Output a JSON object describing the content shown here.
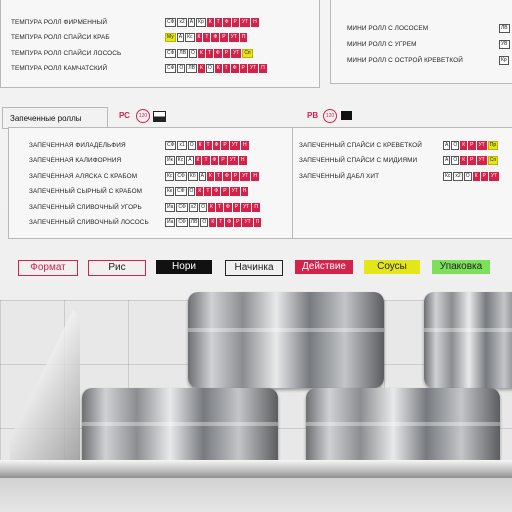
{
  "top_left": {
    "rows": [
      {
        "name": "ТЕМПУРА РОЛЛ ФИРМЕННЫЙ",
        "codes": [
          [
            "СФ",
            ""
          ],
          [
            "х2",
            ""
          ],
          [
            "А",
            ""
          ],
          [
            "Кр",
            ""
          ],
          [
            "К",
            "d"
          ],
          [
            "Т",
            "d"
          ],
          [
            "Ф",
            "d"
          ],
          [
            "Р",
            "d"
          ],
          [
            "УТ",
            "d"
          ],
          [
            "Н",
            "d"
          ]
        ]
      },
      {
        "name": "ТЕМПУРА РОЛЛ СПАЙСИ КРАБ",
        "codes": [
          [
            "Му",
            "s"
          ],
          [
            "А",
            ""
          ],
          [
            "Кс",
            ""
          ],
          [
            "К",
            "d"
          ],
          [
            "Т",
            "d"
          ],
          [
            "Ф",
            "d"
          ],
          [
            "Р",
            "d"
          ],
          [
            "УТ",
            "d"
          ],
          [
            "П",
            "d"
          ]
        ]
      },
      {
        "name": "ТЕМПУРА РОЛЛ СПАЙСИ ЛОСОСЬ",
        "codes": [
          [
            "СФ",
            ""
          ],
          [
            "ЛВ",
            ""
          ],
          [
            "О",
            ""
          ],
          [
            "К",
            "d"
          ],
          [
            "Т",
            "d"
          ],
          [
            "Ф",
            "d"
          ],
          [
            "Р",
            "d"
          ],
          [
            "УТ",
            "d"
          ],
          [
            "Сп",
            "s"
          ]
        ]
      },
      {
        "name": "ТЕМПУРА РОЛЛ КАМЧАТСКИЙ",
        "codes": [
          [
            "СФ",
            ""
          ],
          [
            "О",
            ""
          ],
          [
            "ЛВ",
            ""
          ],
          [
            "К",
            "d"
          ],
          [
            "О",
            ""
          ],
          [
            "К",
            "d"
          ],
          [
            "Т",
            "d"
          ],
          [
            "Ф",
            "d"
          ],
          [
            "Р",
            "d"
          ],
          [
            "УТ",
            "d"
          ],
          [
            "П",
            "d"
          ]
        ]
      }
    ]
  },
  "top_right": {
    "rows": [
      {
        "name": "МИНИ РОЛЛ С ЛОСОСЕМ",
        "code": "ЛВ"
      },
      {
        "name": "МИНИ РОЛЛ С УГРЕМ",
        "code": "УВ"
      },
      {
        "name": "МИНИ РОЛЛ С ОСТРОЙ КРЕВЕТКОЙ",
        "code": "Кр"
      }
    ]
  },
  "baked": {
    "title": "Запеченные роллы",
    "badge_left": "РС",
    "circle_left": "120",
    "badge_right": "РВ",
    "circle_right": "120",
    "left_rows": [
      {
        "name": "ЗАПЕЧЕННАЯ ФИЛАДЕЛЬФИЯ",
        "codes": [
          [
            "СФ",
            ""
          ],
          [
            "х1",
            ""
          ],
          [
            "О",
            ""
          ],
          [
            "К",
            "d"
          ],
          [
            "Т",
            "d"
          ],
          [
            "Ф",
            "d"
          ],
          [
            "Р",
            "d"
          ],
          [
            "УТ",
            "d"
          ],
          [
            "Н",
            "d"
          ]
        ]
      },
      {
        "name": "ЗАПЕЧЕННАЯ КАЛИФОРНИЯ",
        "codes": [
          [
            "Ик",
            ""
          ],
          [
            "Кс",
            ""
          ],
          [
            "А",
            ""
          ],
          [
            "К",
            "d"
          ],
          [
            "Т",
            "d"
          ],
          [
            "Ф",
            "d"
          ],
          [
            "Р",
            "d"
          ],
          [
            "УТ",
            "d"
          ],
          [
            "Н",
            "d"
          ]
        ]
      },
      {
        "name": "ЗАПЕЧЕННАЯ АЛЯСКА С КРАБОМ",
        "codes": [
          [
            "Кс",
            ""
          ],
          [
            "СФ",
            ""
          ],
          [
            "Кб",
            ""
          ],
          [
            "А",
            ""
          ],
          [
            "К",
            "d"
          ],
          [
            "Т",
            "d"
          ],
          [
            "Ф",
            "d"
          ],
          [
            "Р",
            "d"
          ],
          [
            "УТ",
            "d"
          ],
          [
            "Н",
            "d"
          ]
        ]
      },
      {
        "name": "ЗАПЕЧЕННЫЙ СЫРНЫЙ С КРАБОМ",
        "codes": [
          [
            "Кк",
            ""
          ],
          [
            "СФ",
            ""
          ],
          [
            "О",
            ""
          ],
          [
            "К",
            "d"
          ],
          [
            "Т",
            "d"
          ],
          [
            "Ф",
            "d"
          ],
          [
            "Р",
            "d"
          ],
          [
            "УТ",
            "d"
          ],
          [
            "Н",
            "d"
          ]
        ]
      },
      {
        "name": "ЗАПЕЧЕННЫЙ СЛИВОЧНЫЙ УГОРЬ",
        "codes": [
          [
            "Иа",
            ""
          ],
          [
            "СФ",
            ""
          ],
          [
            "х2",
            ""
          ],
          [
            "О",
            ""
          ],
          [
            "К",
            "d"
          ],
          [
            "Т",
            "d"
          ],
          [
            "Ф",
            "d"
          ],
          [
            "Р",
            "d"
          ],
          [
            "УТ",
            "d"
          ],
          [
            "П",
            "d"
          ]
        ]
      },
      {
        "name": "ЗАПЕЧЕННЫЙ СЛИВОЧНЫЙ ЛОСОСЬ",
        "codes": [
          [
            "Иа",
            ""
          ],
          [
            "СФ",
            ""
          ],
          [
            "ЛВ",
            ""
          ],
          [
            "О",
            ""
          ],
          [
            "К",
            "d"
          ],
          [
            "Т",
            "d"
          ],
          [
            "Ф",
            "d"
          ],
          [
            "Р",
            "d"
          ],
          [
            "УТ",
            "d"
          ],
          [
            "П",
            "d"
          ]
        ]
      }
    ],
    "right_rows": [
      {
        "name": "ЗАПЕЧЕННЫЙ СПАЙСИ С КРЕВЕТКОЙ",
        "codes": [
          [
            "А",
            ""
          ],
          [
            "О",
            ""
          ],
          [
            "К",
            "d"
          ],
          [
            "Р",
            "d"
          ],
          [
            "УТ",
            "d"
          ],
          [
            "Пр",
            "s"
          ]
        ]
      },
      {
        "name": "ЗАПЕЧЕННЫЙ СПАЙСИ С МИДИЯМИ",
        "codes": [
          [
            "А",
            ""
          ],
          [
            "О",
            ""
          ],
          [
            "К",
            "d"
          ],
          [
            "Р",
            "d"
          ],
          [
            "УТ",
            "d"
          ],
          [
            "Сп",
            "s"
          ]
        ]
      },
      {
        "name": "ЗАПЕЧЕННЫЙ ДАБЛ ХИТ",
        "codes": [
          [
            "Кс",
            ""
          ],
          [
            "х2",
            ""
          ],
          [
            "О",
            ""
          ],
          [
            "К",
            "d"
          ],
          [
            "Р",
            "d"
          ],
          [
            "УТ",
            "d"
          ]
        ]
      }
    ]
  },
  "legend": [
    {
      "label": "Формат",
      "style": "f"
    },
    {
      "label": "Рис",
      "style": "r"
    },
    {
      "label": "Нори",
      "style": "n"
    },
    {
      "label": "Начинка",
      "style": "c"
    },
    {
      "label": "Действие",
      "style": "d"
    },
    {
      "label": "Соусы",
      "style": "s"
    },
    {
      "label": "Упаковка",
      "style": "u"
    }
  ],
  "colors": {
    "red": "#d3234a",
    "yellow": "#e5e617",
    "green": "#7ce05a",
    "black": "#111111"
  }
}
